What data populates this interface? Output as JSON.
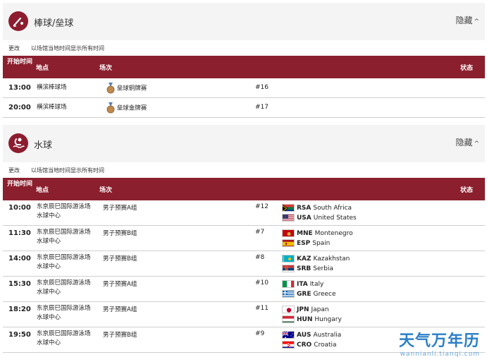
{
  "sections": [
    {
      "title": "棒球/垒球",
      "hide_label": "隐藏",
      "change_label": "更改",
      "timezone_note": "以场馆当地时间显示所有时间",
      "columns": {
        "time": "开始时间",
        "venue": "地点",
        "event": "场次",
        "status": "状态"
      },
      "rows": [
        {
          "time": "13:00",
          "venue": "横滨棒球场",
          "event": "垒球铜牌赛",
          "num": "#16"
        },
        {
          "time": "20:00",
          "venue": "横滨棒球场",
          "event": "垒球金牌赛",
          "num": "#17"
        }
      ]
    },
    {
      "title": "水球",
      "hide_label": "隐藏",
      "change_label": "更改",
      "timezone_note": "以场馆当地时间显示所有时间",
      "columns": {
        "time": "开始时间",
        "venue": "地点",
        "event": "场次",
        "status": "状态"
      },
      "rows": [
        {
          "time": "10:00",
          "venue": "东京辰巳国际游泳场水球中心",
          "event": "男子预赛A组",
          "num": "#12",
          "teams": [
            {
              "flag": "RSA",
              "code": "RSA",
              "name": "South Africa"
            },
            {
              "flag": "USA",
              "code": "USA",
              "name": "United States"
            }
          ]
        },
        {
          "time": "11:30",
          "venue": "东京辰巳国际游泳场水球中心",
          "event": "男子预赛B组",
          "num": "#7",
          "teams": [
            {
              "flag": "MNE",
              "code": "MNE",
              "name": "Montenegro"
            },
            {
              "flag": "ESP",
              "code": "ESP",
              "name": "Spain"
            }
          ]
        },
        {
          "time": "14:00",
          "venue": "东京辰巳国际游泳场水球中心",
          "event": "男子预赛B组",
          "num": "#8",
          "teams": [
            {
              "flag": "KAZ",
              "code": "KAZ",
              "name": "Kazakhstan"
            },
            {
              "flag": "SRB",
              "code": "SRB",
              "name": "Serbia"
            }
          ]
        },
        {
          "time": "15:30",
          "venue": "东京辰巳国际游泳场水球中心",
          "event": "男子预赛A组",
          "num": "#10",
          "teams": [
            {
              "flag": "ITA",
              "code": "ITA",
              "name": "Italy"
            },
            {
              "flag": "GRE",
              "code": "GRE",
              "name": "Greece"
            }
          ]
        },
        {
          "time": "18:20",
          "venue": "东京辰巳国际游泳场水球中心",
          "event": "男子预赛A组",
          "num": "#11",
          "teams": [
            {
              "flag": "JPN",
              "code": "JPN",
              "name": "Japan"
            },
            {
              "flag": "HUN",
              "code": "HUN",
              "name": "Hungary"
            }
          ]
        },
        {
          "time": "19:50",
          "venue": "东京辰巳国际游泳场水球中心",
          "event": "男子预赛B组",
          "num": "#9",
          "teams": [
            {
              "flag": "AUS",
              "code": "AUS",
              "name": "Australia"
            },
            {
              "flag": "CRO",
              "code": "CRO",
              "name": "Croatia"
            }
          ]
        }
      ]
    }
  ],
  "watermark": {
    "main": "天气万年历",
    "sub": "wannianli.tianqi.com"
  },
  "colors": {
    "header": "#8b1f2e",
    "icon_bg": "#8c1d2f",
    "watermark": "#2b7fc7"
  }
}
